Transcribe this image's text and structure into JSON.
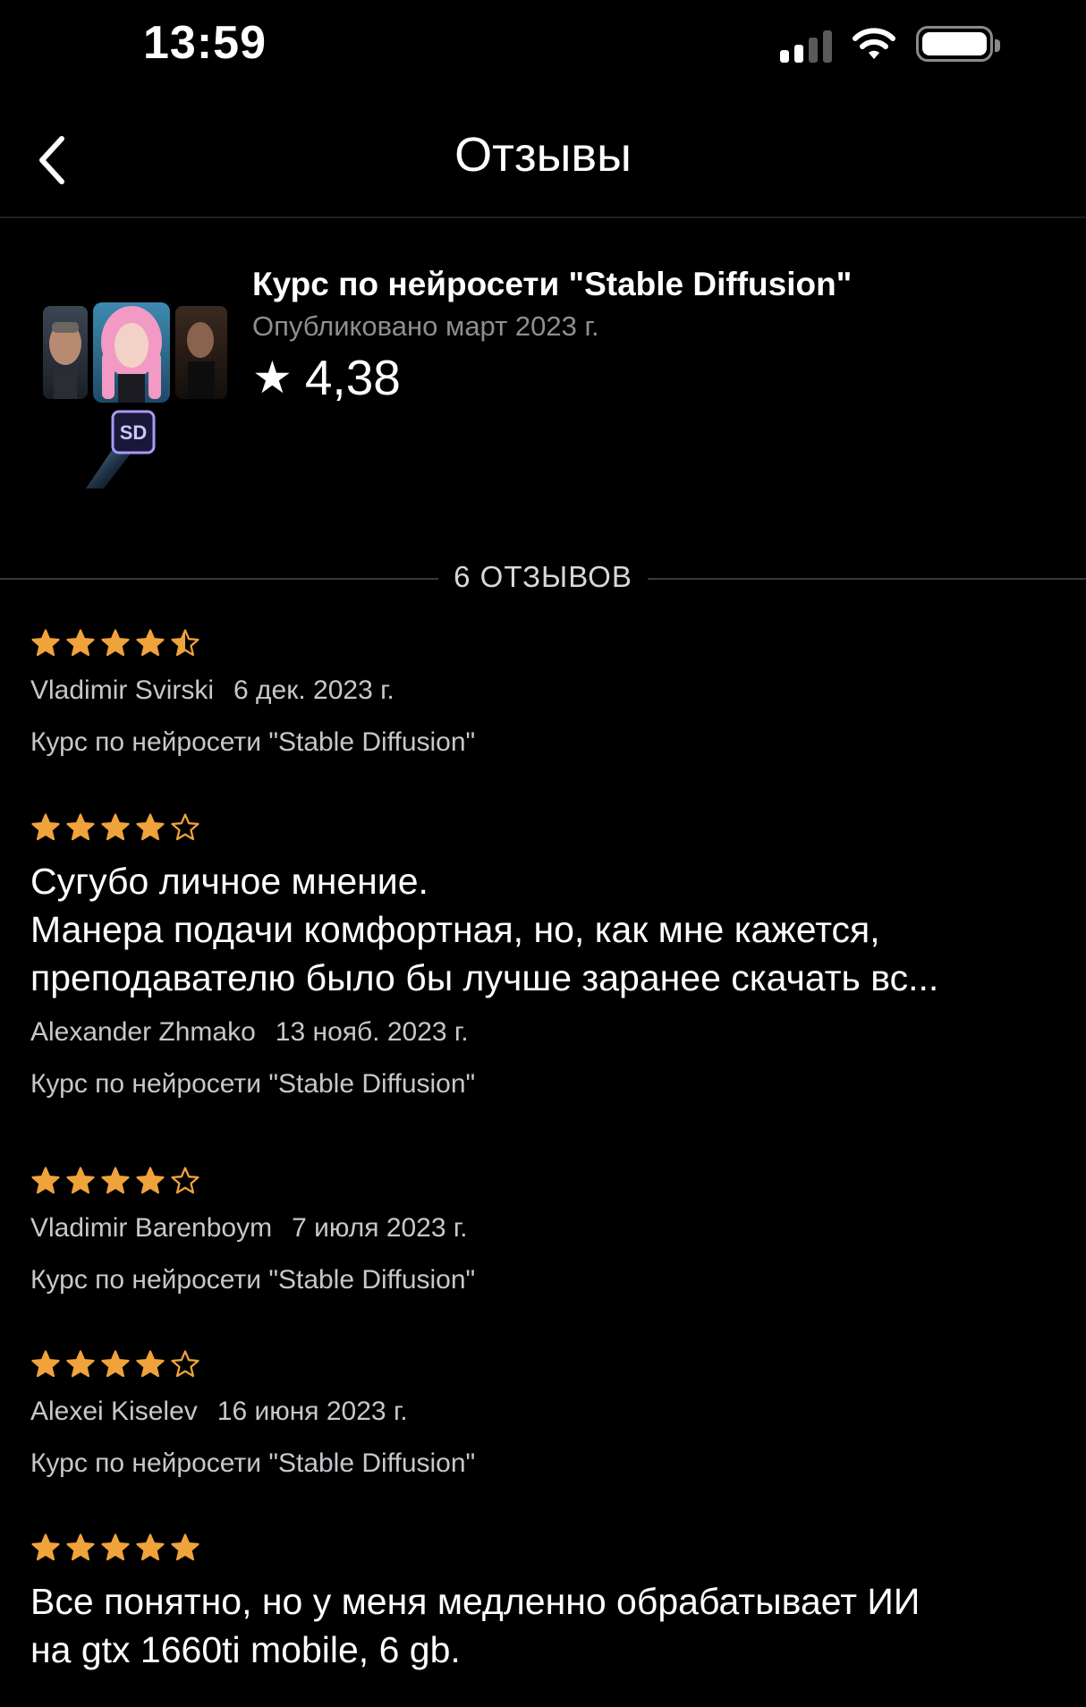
{
  "status_bar": {
    "time": "13:59",
    "icons": [
      "cellular-signal-icon",
      "wifi-icon",
      "battery-icon"
    ],
    "signal_bars_active": 2,
    "signal_bars_total": 4
  },
  "nav": {
    "title": "Отзывы",
    "back_icon": "chevron-left-icon"
  },
  "course": {
    "title": "Курс по нейросети \"Stable Diffusion\"",
    "published": "Опубликовано март 2023 г.",
    "rating": "4,38",
    "rating_icon": "star-icon",
    "thumbnail_badge": "SD"
  },
  "reviews_header": {
    "label": "6 ОТЗЫВОВ"
  },
  "colors": {
    "star": "#f0a33a",
    "background": "#000000",
    "secondary_text": "#8e8e93",
    "meta_text": "#c7c7cc"
  },
  "reviews": [
    {
      "rating": 4.5,
      "text": "",
      "author": "Vladimir Svirski",
      "date": "6 дек. 2023 г.",
      "course": "Курс по нейросети \"Stable Diffusion\""
    },
    {
      "rating": 4,
      "text": "Сугубо личное мнение.\nМанера подачи комфортная, но, как мне кажется, преподавателю было бы лучше заранее скачать вс...",
      "author": "Alexander Zhmako",
      "date": "13 нояб. 2023 г.",
      "course": "Курс по нейросети \"Stable Diffusion\""
    },
    {
      "rating": 4,
      "text": "",
      "author": "Vladimir Barenboym",
      "date": "7 июля 2023 г.",
      "course": "Курс по нейросети \"Stable Diffusion\""
    },
    {
      "rating": 4,
      "text": "",
      "author": "Alexei Kiselev",
      "date": "16 июня 2023 г.",
      "course": "Курс по нейросети \"Stable Diffusion\""
    },
    {
      "rating": 5,
      "text": "Все понятно, но у меня медленно обрабатывает ИИ\nна gtx 1660ti mobile, 6 gb.",
      "author": "",
      "date": "",
      "course": ""
    }
  ]
}
